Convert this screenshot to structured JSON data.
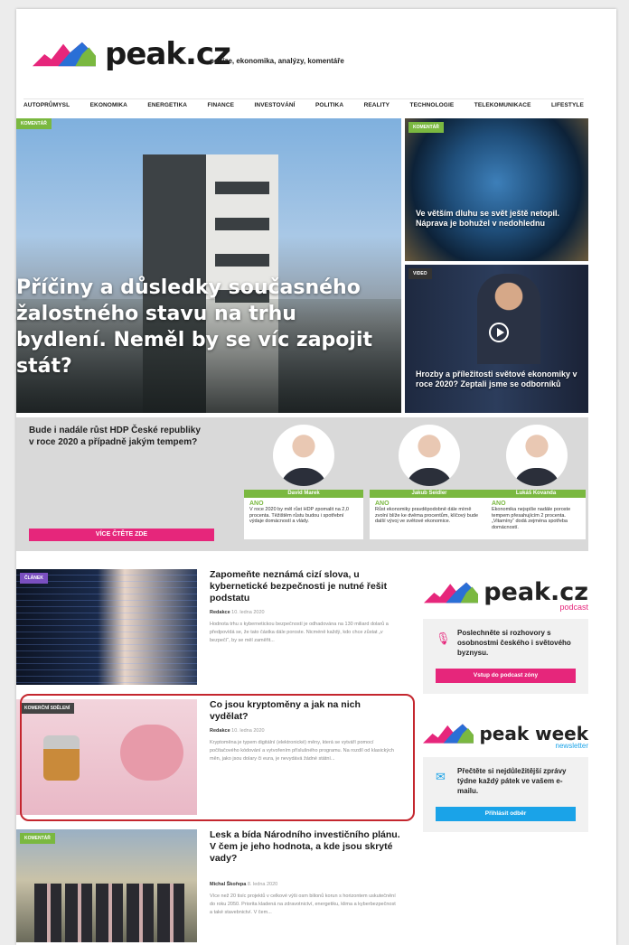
{
  "header": {
    "logo_text": "peak.cz",
    "tagline": "peníze, ekonomika, analýzy, komentáře"
  },
  "nav": [
    "AUTOPRŮMYSL",
    "EKONOMIKA",
    "ENERGETIKA",
    "FINANCE",
    "INVESTOVÁNÍ",
    "POLITIKA",
    "REALITY",
    "TECHNOLOGIE",
    "TELEKOMUNIKACE",
    "LIFESTYLE"
  ],
  "hero": {
    "tag": "KOMENTÁŘ",
    "title": "Příčiny a důsledky současného žalostného stavu na trhu bydlení. Neměl by se víc zapojit stát?"
  },
  "side_top": {
    "tag": "KOMENTÁŘ",
    "title": "Ve větším dluhu se svět ještě netopil. Náprava je bohužel v nedohlednu"
  },
  "side_video": {
    "tag": "VIDEO",
    "title": "Hrozby a příležitosti světové ekonomiky v roce 2020? Zeptali jsme se odborníků"
  },
  "poll": {
    "question": "Bude i nadále růst HDP České republiky v roce 2020 a případně jakým tempem?",
    "button": "VÍCE ČTĚTE ZDE",
    "people": [
      {
        "name": "David Marek",
        "answer": "ANO",
        "text": "V roce 2020 by měl růst HDP zpomalit na 2,0 procenta. Těžištěm růstu budou i spotřební výdaje domácností a vlády."
      },
      {
        "name": "Jakub Seidler",
        "answer": "ANO",
        "text": "Růst ekonomiky pravděpodobně dále mírně zvolní blíže ke dvěma procentům, klíčový bude další vývoj ve světové ekonomice."
      },
      {
        "name": "Lukáš Kovanda",
        "answer": "ANO",
        "text": "Ekonomika nejspíše nadále poroste tempem přesahujícím 2 procenta. „Vitamíny“ dodá zejména spotřeba domácností."
      }
    ]
  },
  "articles": [
    {
      "tag": "ČLÁNEK",
      "title": "Zapomeňte neznámá cizí slova, u kybernetické bezpečnosti je nutné řešit podstatu",
      "author": "Redakce",
      "date": "10. ledna 2020",
      "excerpt": "Hodnota trhu s kybernetickou bezpečností je odhadována na 130 miliard dolarů a předpovídá se, že tato částka dále poroste. Nicméně každý, kdo chce zůstat „v bezpečí“, by se měl zaměřit..."
    },
    {
      "tag": "KOMERČNÍ SDĚLENÍ",
      "title": "Co jsou kryptoměny a jak na nich vydělat?",
      "author": "Redakce",
      "date": "10. ledna 2020",
      "excerpt": "Kryptoměna je typem digitální (elektronické) měny, která se vytváří pomocí počítačového kódování a vytvořením příslušného programu. Na rozdíl od klasických měn, jako jsou dolary či eura, je nevydává žádné státní..."
    },
    {
      "tag": "KOMENTÁŘ",
      "title": "Lesk a bída Národního investičního plánu. V čem je jeho hodnota, a kde jsou skryté vady?",
      "author": "Michal Škořepa",
      "date": "8. ledna 2020",
      "excerpt": "Více než 20 tisíc projektů v celkové výši osm bilionů korun s horizontem uskutečnění do roku 2050. Priorita kladená na zdravotnictví, energetiku, klima a kyberbezpečnost a také stavebnictví. V čem..."
    }
  ],
  "podcast": {
    "logo_text": "peak.cz",
    "sub": "podcast",
    "text": "Poslechněte si rozhovory s osobnostmi českého i světového byznysu.",
    "button": "Vstup do podcast zóny"
  },
  "newsletter": {
    "logo_text": "peak week",
    "sub": "newsletter",
    "text": "Přečtěte si nejdůležitější zprávy týdne každý pátek ve vašem e-mailu.",
    "button": "Přihlásit odběr"
  },
  "colors": {
    "accent_pink": "#e6267b",
    "accent_green": "#7ab840",
    "accent_blue": "#1aa3e8",
    "highlight": "#c4262e"
  }
}
